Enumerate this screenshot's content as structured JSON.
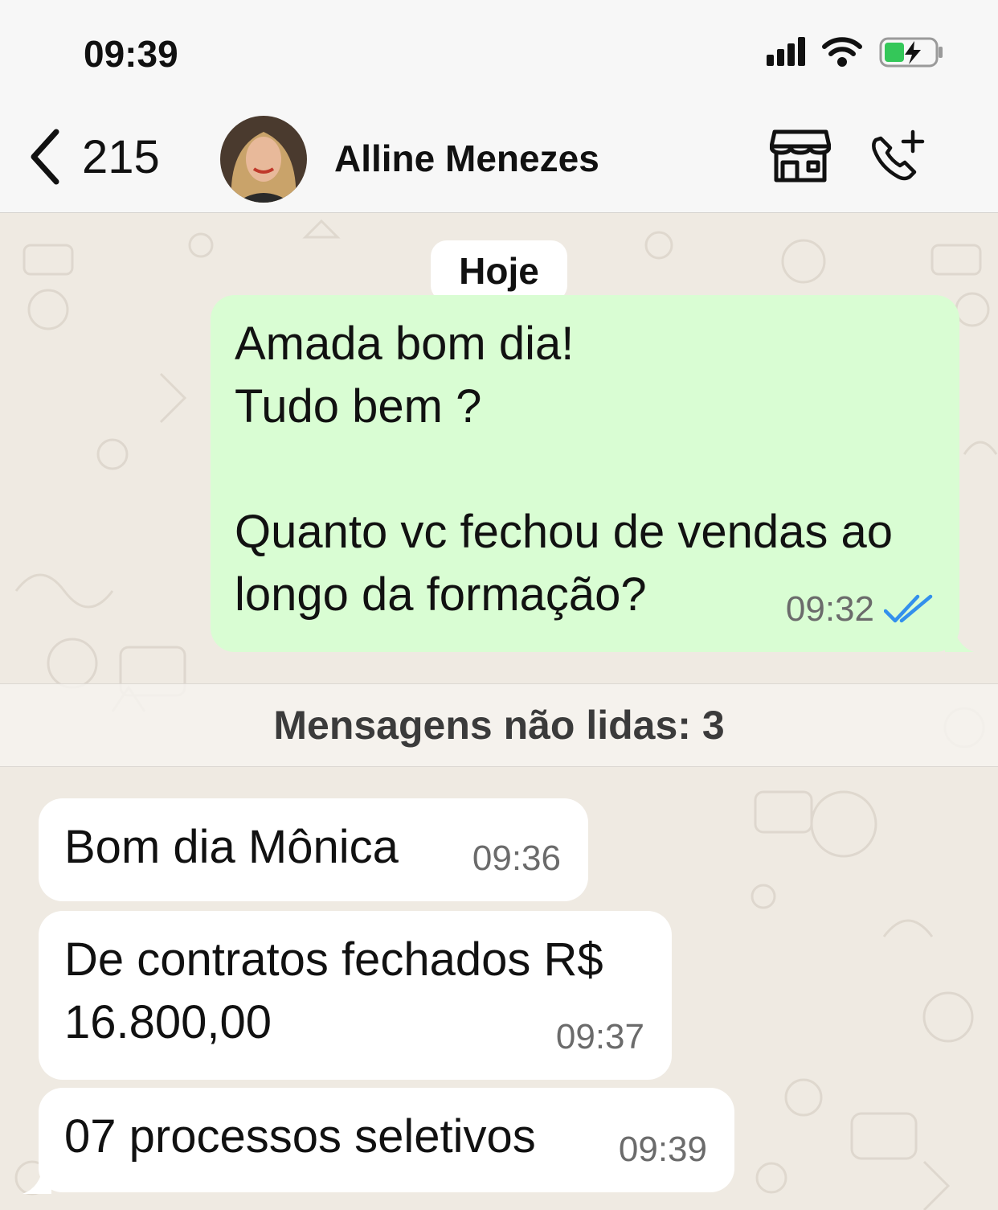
{
  "status": {
    "time": "09:39"
  },
  "header": {
    "back_count": "215",
    "contact_name": "Alline Menezes"
  },
  "chat": {
    "date_label": "Hoje",
    "outgoing": {
      "text": "Amada bom dia!\nTudo bem ?\n\nQuanto vc fechou de vendas ao\nlongo da formação?",
      "time": "09:32"
    },
    "unread_label": "Mensagens não lidas: 3",
    "incoming": [
      {
        "text": "Bom dia Mônica",
        "time": "09:36"
      },
      {
        "text": "De contratos fechados R$\n16.800,00",
        "time": "09:37"
      },
      {
        "text": "07 processos seletivos",
        "time": "09:39"
      }
    ]
  },
  "colors": {
    "outgoing_bubble": "#d9fdd3",
    "incoming_bubble": "#ffffff",
    "read_ticks": "#3390ec",
    "chat_bg": "#efeae2"
  }
}
